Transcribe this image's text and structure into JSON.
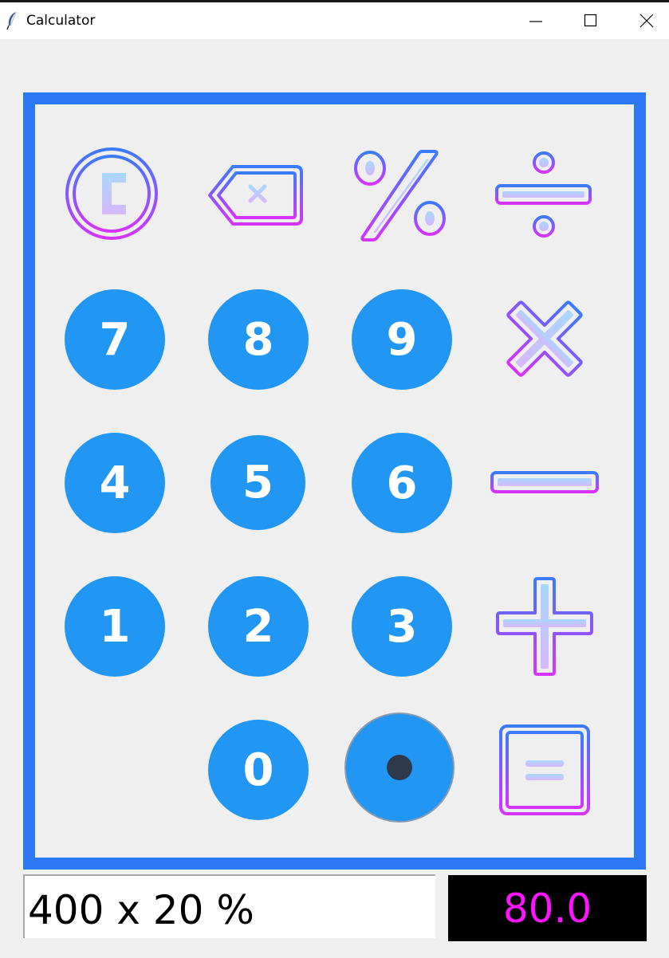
{
  "window": {
    "title": "Calculator",
    "icon": "feather-icon",
    "controls": [
      "minimize-icon",
      "maximize-icon",
      "close-icon"
    ]
  },
  "keys": {
    "top_row": [
      "clear-icon",
      "backspace-icon",
      "percent-icon",
      "divide-icon"
    ],
    "operators": [
      "multiply-icon",
      "minus-icon",
      "plus-icon",
      "equals-icon"
    ],
    "decimal": "dot-icon",
    "digits": {
      "seven": "7",
      "eight": "8",
      "nine": "9",
      "four": "4",
      "five": "5",
      "six": "6",
      "one": "1",
      "two": "2",
      "three": "3",
      "zero": "0"
    }
  },
  "display": {
    "expression": "400 x 20 %",
    "result": "80.0"
  },
  "colors": {
    "frame_border": "#2f78f5",
    "digit_button": "#2196f3",
    "digit_text": "#ffffff",
    "icon_gradient_top": "#3a7bff",
    "icon_gradient_bottom": "#d633ff",
    "icon_fill_top": "#a8d8ff",
    "icon_fill_bottom": "#d7b8ff",
    "result_background": "#000000",
    "result_text": "#ff14ff"
  }
}
